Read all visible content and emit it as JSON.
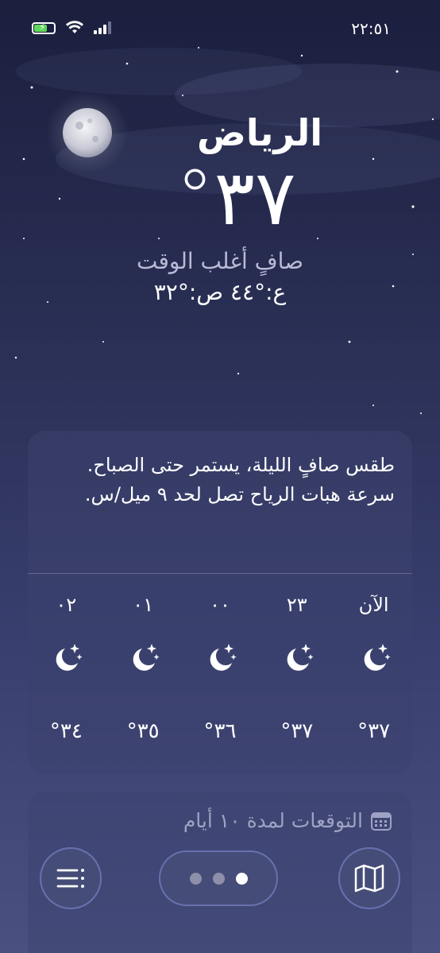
{
  "status_bar": {
    "time": "٢٢:٥١"
  },
  "location": {
    "city": "الرياض",
    "temperature": "°٣٧",
    "condition": "صافٍ أغلب الوقت",
    "high_low": "ع:°٤٤  ص:°٣٢"
  },
  "hourly": {
    "summary": "طقس صافٍ الليلة، يستمر حتى الصباح. سرعة هبات الرياح تصل لحد ٩ ميل/س.",
    "items": [
      {
        "label": "الآن",
        "temp": "°٣٧",
        "icon": "moon-stars-icon"
      },
      {
        "label": "٢٣",
        "temp": "°٣٧",
        "icon": "moon-stars-icon"
      },
      {
        "label": "٠٠",
        "temp": "°٣٦",
        "icon": "moon-stars-icon"
      },
      {
        "label": "٠١",
        "temp": "°٣٥",
        "icon": "moon-stars-icon"
      },
      {
        "label": "٠٢",
        "temp": "°٣٤",
        "icon": "moon-stars-icon"
      }
    ]
  },
  "forecast": {
    "title": "التوقعات لمدة ١٠ أيام",
    "icon": "calendar-icon"
  },
  "bottom_bar": {
    "map_icon": "map-icon",
    "list_icon": "list-icon",
    "pages": 3,
    "active_page": 1
  }
}
